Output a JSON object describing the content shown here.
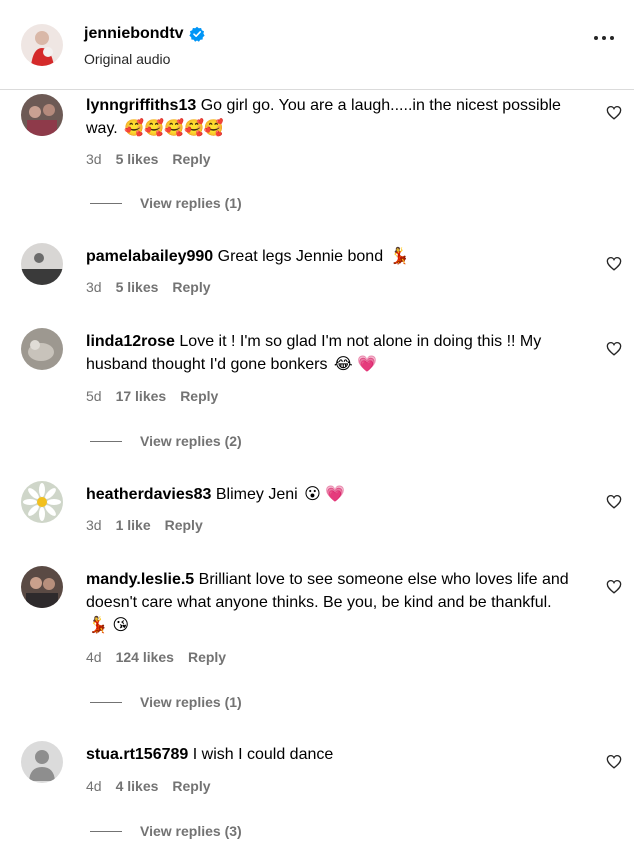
{
  "header": {
    "username": "jenniebondtv",
    "subtitle": "Original audio"
  },
  "comments": [
    {
      "username": "lynngriffiths13",
      "text": "Go girl go. You are a laugh.....in the nicest possible way.",
      "emojis": "🥰🥰🥰🥰🥰",
      "time": "3d",
      "likes": "5 likes",
      "reply": "Reply",
      "view_replies": "View replies (1)"
    },
    {
      "username": "pamelabailey990",
      "text": "Great legs Jennie bond",
      "emojis": "💃",
      "time": "3d",
      "likes": "5 likes",
      "reply": "Reply"
    },
    {
      "username": "linda12rose",
      "text": "Love it ! I'm so glad I'm not alone in doing this !! My husband thought I'd gone bonkers",
      "emojis": "😂 💗",
      "time": "5d",
      "likes": "17 likes",
      "reply": "Reply",
      "view_replies": "View replies (2)"
    },
    {
      "username": "heatherdavies83",
      "text": "Blimey Jeni",
      "emojis": "😮 💗",
      "time": "3d",
      "likes": "1 like",
      "reply": "Reply"
    },
    {
      "username": "mandy.leslie.5",
      "text": "Brilliant love to see someone else who loves life and doesn't care what anyone thinks. Be you, be kind and be thankful.",
      "emojis": "💃 😘",
      "time": "4d",
      "likes": "124 likes",
      "reply": "Reply",
      "view_replies": "View replies (1)"
    },
    {
      "username": "stua.rt156789",
      "text": "I wish I could dance",
      "emojis": "",
      "time": "4d",
      "likes": "4 likes",
      "reply": "Reply",
      "view_replies": "View replies (3)"
    }
  ],
  "colors": {
    "text": "#000000",
    "secondary": "#737373",
    "verified": "#0095f6",
    "divider": "#dbdbdb"
  },
  "icons": [
    "verified-icon",
    "more-options-icon",
    "heart-icon",
    "default-avatar-icon"
  ]
}
